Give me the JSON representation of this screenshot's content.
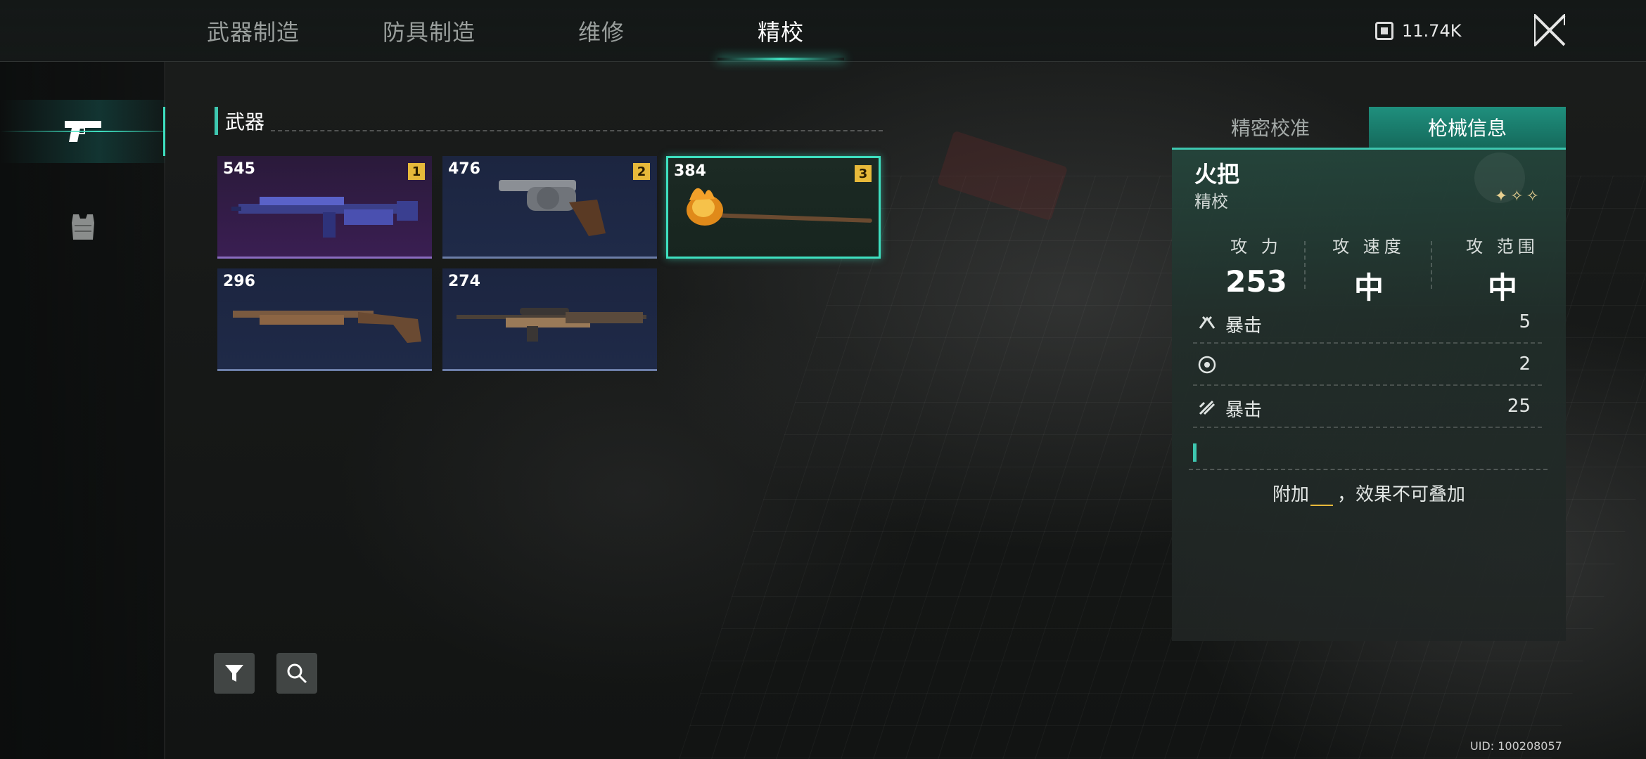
{
  "tabs": [
    {
      "label": "武器制造"
    },
    {
      "label": "防具制造"
    },
    {
      "label": "维修"
    },
    {
      "label": "精校",
      "active": true
    }
  ],
  "currency": {
    "icon": "currency-icon",
    "value": "11.74K"
  },
  "close": {
    "icon": "close-icon"
  },
  "rail": [
    {
      "icon": "pistol-icon",
      "active": true
    },
    {
      "icon": "armor-vest-icon",
      "active": false
    }
  ],
  "section": {
    "title": "武器"
  },
  "weapons": [
    {
      "score": "545",
      "rank": "1",
      "icon": "assault-rifle-icon",
      "rarity": "purple"
    },
    {
      "score": "476",
      "rank": "2",
      "icon": "revolver-icon",
      "rarity": "blue"
    },
    {
      "score": "384",
      "rank": "3",
      "icon": "torch-icon",
      "rarity": "selected"
    },
    {
      "score": "296",
      "icon": "shotgun-icon",
      "rarity": "blue"
    },
    {
      "score": "274",
      "icon": "sniper-rifle-icon",
      "rarity": "blue"
    }
  ],
  "tools": [
    {
      "icon": "filter-icon"
    },
    {
      "icon": "search-icon"
    }
  ],
  "panel": {
    "tabs": [
      {
        "label": "精密校准"
      },
      {
        "label": "枪械信息",
        "active": true
      }
    ],
    "item_name": "火把",
    "item_sub": "精校",
    "stars": "✦✧✧",
    "stats": [
      {
        "label": "攻 力",
        "value": "253"
      },
      {
        "label": "攻 速度",
        "value": "中"
      },
      {
        "label": "攻 范围",
        "value": "中"
      }
    ],
    "props": [
      {
        "icon": "crit-icon",
        "label": "暴击",
        "value": "5"
      },
      {
        "icon": "target-icon",
        "label": "",
        "value": "2"
      },
      {
        "icon": "crit-damage-icon",
        "label": "暴击",
        "value": "25"
      }
    ],
    "effect": {
      "prefix": "附加",
      "suffix": "，效果不可叠加"
    }
  },
  "uid": "UID: 100208057",
  "colors": {
    "accent": "#3ee0c0",
    "rank_badge": "#e7b93a"
  }
}
